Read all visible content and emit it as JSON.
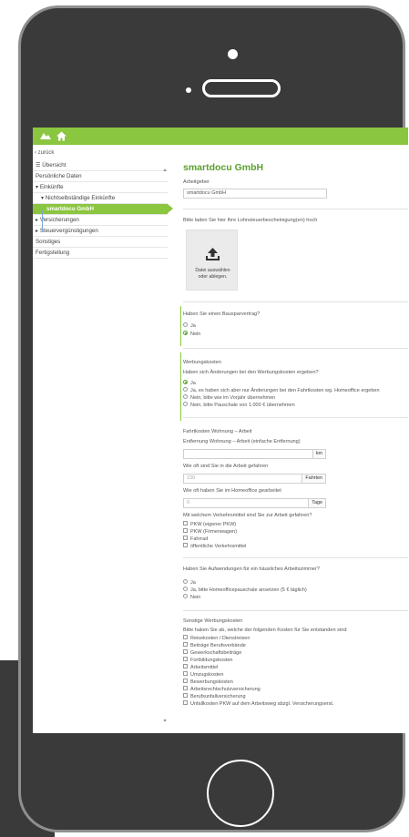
{
  "nav": {
    "back": "zurück",
    "items": [
      {
        "label": "Übersicht",
        "level": 0,
        "icon": "list-icon"
      },
      {
        "label": "Persönliche Daten",
        "level": 0
      },
      {
        "label": "Einkünfte",
        "level": 0,
        "icon": "caret-down-icon"
      },
      {
        "label": "Nichtselbständige Einkünfte",
        "level": 1,
        "icon": "caret-down-icon"
      },
      {
        "label": "smartdocu GmbH",
        "level": 2,
        "active": true
      },
      {
        "label": "Versicherungen",
        "level": 0,
        "icon": "caret-right-icon"
      },
      {
        "label": "Steuervergünstigungen",
        "level": 0,
        "icon": "caret-right-icon"
      },
      {
        "label": "Sonstiges",
        "level": 0
      },
      {
        "label": "Fertigstellung",
        "level": 0
      }
    ]
  },
  "main": {
    "title": "smartdocu GmbH",
    "employer_label": "Arbeitgeber",
    "employer_value": "smartdocu GmbH",
    "upload_prompt": "Bitte laden Sie hier Ihre Lohnsteuerbescheinigung(en) hoch",
    "upload_line1": "Datei auswählen",
    "upload_line2": "oder ablegen.",
    "bauspar": {
      "question": "Haben Sie einen Bausparvertrag?",
      "options": [
        "Ja",
        "Nein"
      ],
      "selected": "Nein"
    },
    "werbungskosten": {
      "heading": "Werbungskosten",
      "question": "Haben sich Änderungen bei den Werbungskosten ergeben?",
      "options": [
        "Ja",
        "Ja, es haben sich aber nur Änderungen bei den Fahrtkosten wg. Homeoffice ergeben",
        "Nein, bitte wie im Vorjahr übernehmen",
        "Nein, bitte Pauschale von 1.000 € übernehmen"
      ],
      "selected": "Ja"
    },
    "fahrtkosten": {
      "heading": "Fahrtkosten Wohnung – Arbeit",
      "distance_label": "Entfernung Wohnung – Arbeit (einfache Entfernung)",
      "distance_value": "",
      "distance_unit": "km",
      "trips_label": "Wie oft sind Sie in die Arbeit gefahren",
      "trips_placeholder": "230",
      "trips_unit": "Fahrten",
      "homeoffice_label": "Wie oft haben Sie im Homeoffice gearbeitet",
      "homeoffice_placeholder": "0",
      "homeoffice_unit": "Tage",
      "transport_label": "Mit welchem Verkehrsmittel sind Sie zur Arbeit gefahren?",
      "transport_options": [
        "PKW (eigener PKW)",
        "PKW (Firmenwagen)",
        "Fahrrad",
        "öffentliche Verkehrsmittel"
      ]
    },
    "arbeitszimmer": {
      "question": "Haben Sie Aufwendungen für ein häusliches Arbeitszimmer?",
      "options": [
        "Ja",
        "Ja, bitte Homeofficepauschale ansetzen (5 € täglich)",
        "Nein"
      ]
    },
    "sonstige": {
      "heading": "Sonstige Werbungskosten",
      "question": "Bitte haken Sie ab, welche der folgenden Kosten für Sie entstanden sind",
      "options": [
        "Reisekosten / Dienstreisen",
        "Beiträge Berufsverbände",
        "Gewerkschaftsbeiträge",
        "Fortbildungskosten",
        "Arbeitsmittel",
        "Umzugskosten",
        "Bewerbungskosten",
        "Arbeitsrechtschutzversicherung",
        "Berufsunfallversicherung",
        "Unfallkosten PKW auf dem Arbeitsweg abzgl. Versicherungserst."
      ]
    }
  },
  "colors": {
    "accent": "#8ac63f",
    "title": "#5aa02c",
    "frame": "#3a3a3a",
    "border": "#8f8f8f"
  }
}
